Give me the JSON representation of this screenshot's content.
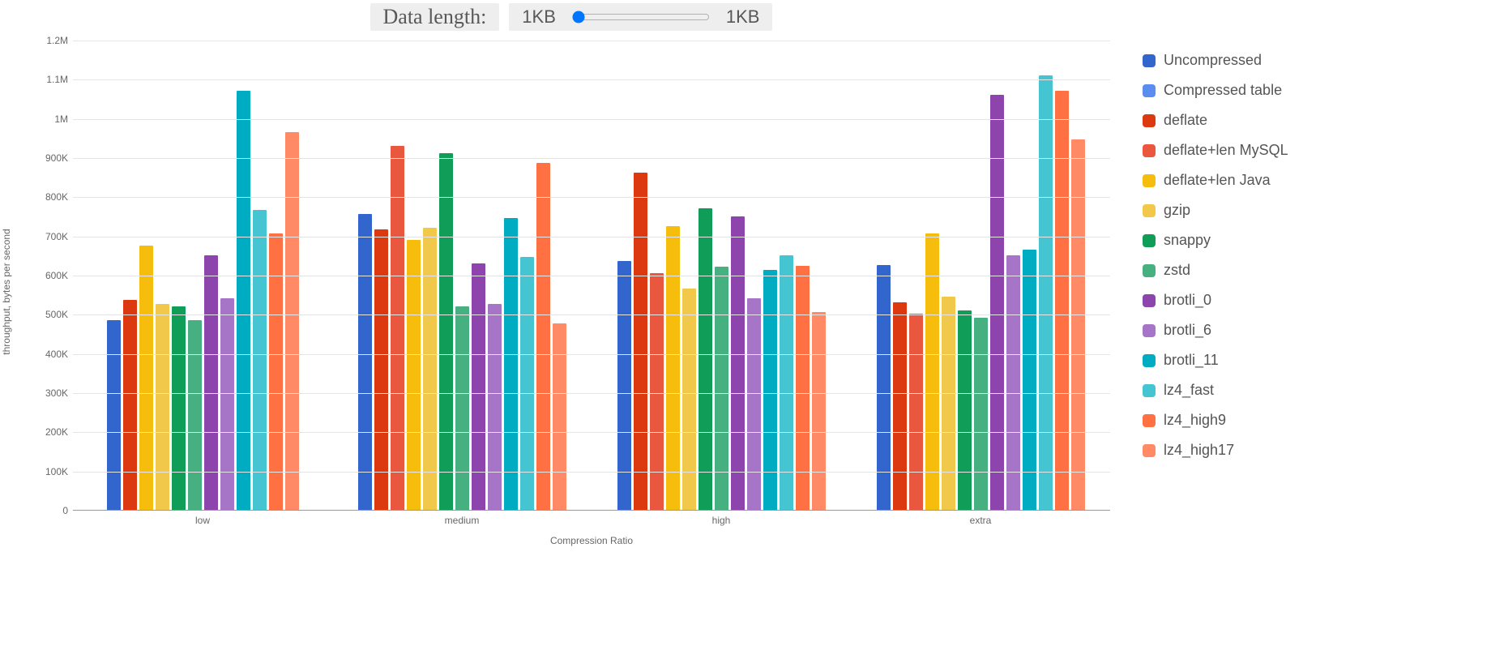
{
  "controls": {
    "label": "Data length:",
    "min_label": "1KB",
    "max_label": "1KB",
    "slider_value": 0
  },
  "chart_data": {
    "type": "bar",
    "title": "",
    "xlabel": "Compression Ratio",
    "ylabel": "throughput, bytes per second",
    "ylim": [
      0,
      1200000
    ],
    "yticks": [
      0,
      100000,
      200000,
      300000,
      400000,
      500000,
      600000,
      700000,
      800000,
      900000,
      1000000,
      1100000,
      1200000
    ],
    "ytick_labels": [
      "0",
      "100K",
      "200K",
      "300K",
      "400K",
      "500K",
      "600K",
      "700K",
      "800K",
      "900K",
      "1M",
      "1.1M",
      "1.2M"
    ],
    "categories": [
      "low",
      "medium",
      "high",
      "extra"
    ],
    "series": [
      {
        "name": "Uncompressed",
        "color": "#3366cc",
        "values": [
          485000,
          755000,
          635000,
          625000
        ]
      },
      {
        "name": "Compressed table",
        "color": "#5b8def",
        "values": [
          null,
          null,
          null,
          null
        ]
      },
      {
        "name": "deflate",
        "color": "#dc3911",
        "values": [
          535000,
          715000,
          860000,
          530000
        ]
      },
      {
        "name": "deflate+len MySQL",
        "color": "#e9573e",
        "values": [
          null,
          930000,
          605000,
          500000
        ]
      },
      {
        "name": "deflate+len Java",
        "color": "#f6bd0d",
        "values": [
          675000,
          690000,
          725000,
          705000
        ]
      },
      {
        "name": "gzip",
        "color": "#f2c84b",
        "values": [
          525000,
          720000,
          565000,
          545000
        ]
      },
      {
        "name": "snappy",
        "color": "#0f9d58",
        "values": [
          520000,
          910000,
          770000,
          510000
        ]
      },
      {
        "name": "zstd",
        "color": "#46b081",
        "values": [
          485000,
          520000,
          620000,
          490000
        ]
      },
      {
        "name": "brotli_0",
        "color": "#8e44ad",
        "values": [
          650000,
          630000,
          750000,
          1060000
        ]
      },
      {
        "name": "brotli_6",
        "color": "#a675c8",
        "values": [
          540000,
          525000,
          540000,
          650000
        ]
      },
      {
        "name": "brotli_11",
        "color": "#00acc1",
        "values": [
          1070000,
          745000,
          612000,
          665000
        ]
      },
      {
        "name": "lz4_fast",
        "color": "#45c4d2",
        "values": [
          765000,
          645000,
          650000,
          1110000
        ]
      },
      {
        "name": "lz4_high9",
        "color": "#ff7043",
        "values": [
          705000,
          885000,
          622000,
          1070000
        ]
      },
      {
        "name": "lz4_high17",
        "color": "#ff8a65",
        "values": [
          965000,
          475000,
          505000,
          945000
        ]
      }
    ]
  }
}
